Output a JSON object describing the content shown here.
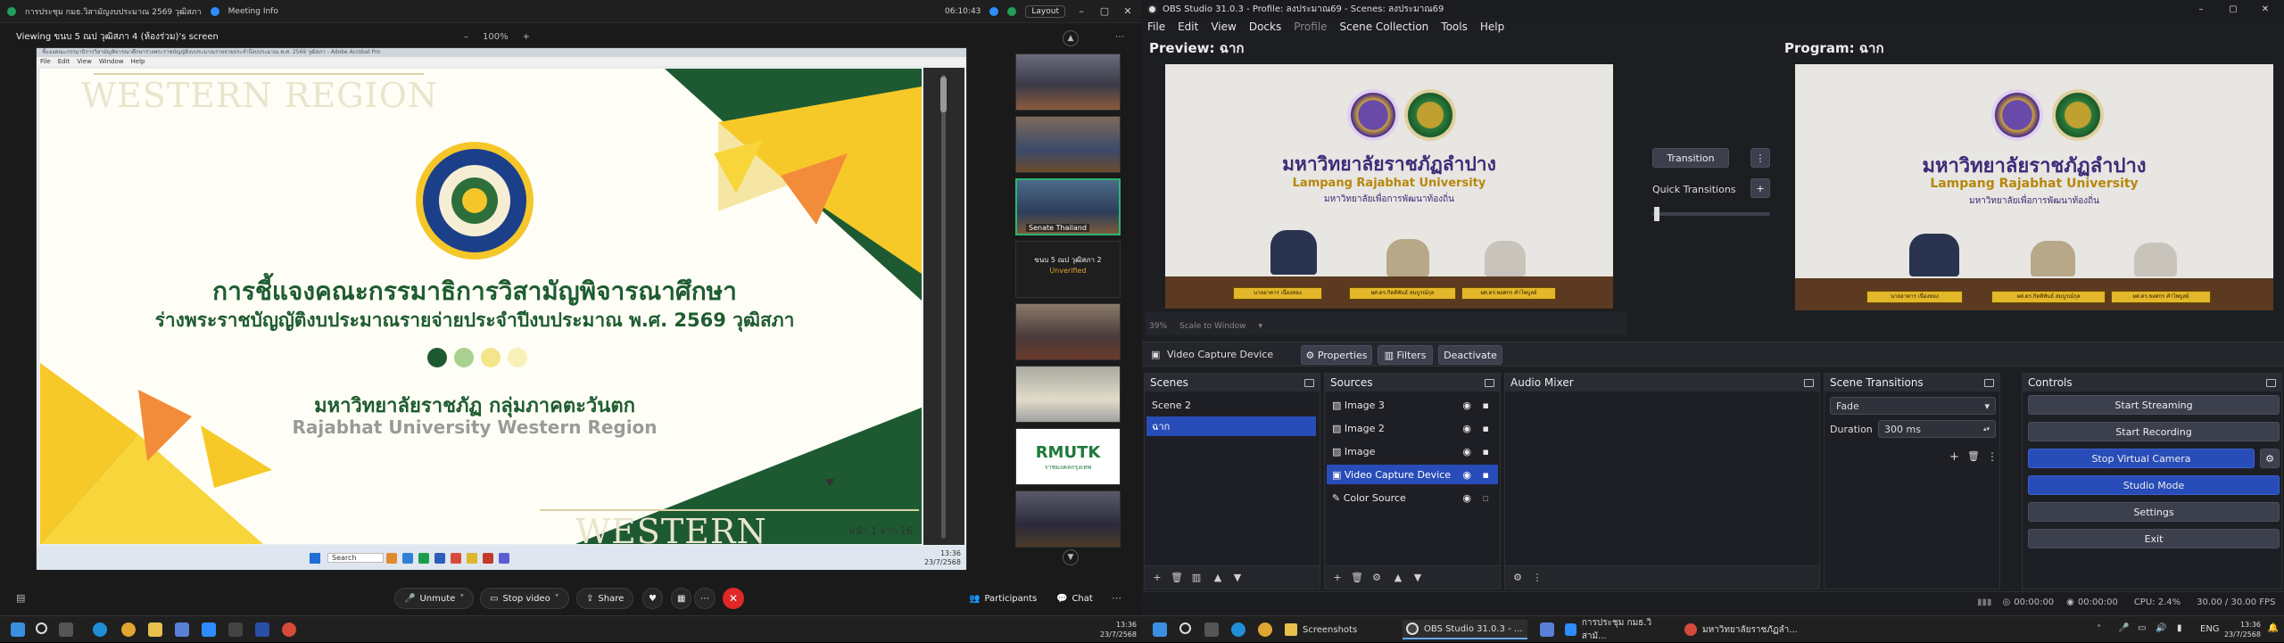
{
  "zoom": {
    "tab_title": "การประชุม กมธ.วิสามัญงบประมาณ 2569 วุฒิสภา",
    "meeting_info": "Meeting Info",
    "timer": "06:10:43",
    "layout_label": "Layout",
    "viewing_label": "Viewing ขนบ 5 ณป วุฒิสภา 4 (ห้องร่วม)'s screen",
    "zoom_pct": "100%",
    "ppt_title": "ชี้แจงคณะกรรมาธิการวิสามัญพิจารณาศึกษาร่างพระราชบัญญัติงบประมาณรายจ่ายประจำปีงบประมาณ พ.ศ. 2569 วุฒิสภา - Adobe Acrobat Pro",
    "ppt_menu": [
      "File",
      "Edit",
      "View",
      "Window",
      "Help"
    ],
    "slide": {
      "watermark_top": "WESTERN REGION",
      "watermark_bottom": "WESTERN REGION",
      "title_line1": "การชี้แจงคณะกรรมาธิการวิสามัญพิจารณาศึกษา",
      "title_line2": "ร่างพระราชบัญญัติงบประมาณรายจ่ายประจำปีงบประมาณ พ.ศ. 2569 วุฒิสภา",
      "org_th": "มหาวิทยาลัยราชภัฏ กลุ่มภาคตะวันตก",
      "org_en": "Rajabhat University Western Region",
      "page": "หน้า 1 จาก 16"
    },
    "mini_taskbar": {
      "search": "Search",
      "time": "13:36",
      "date": "23/7/2568"
    },
    "gallery": [
      {
        "name": ""
      },
      {
        "name": ""
      },
      {
        "name": "Senate Thailand"
      },
      {
        "name": "ขนบ 5 ณป วุฒิสภา 2",
        "note": "Unverified"
      },
      {
        "name": ""
      },
      {
        "name": ""
      },
      {
        "name": "RMUTK"
      },
      {
        "name": ""
      }
    ],
    "rmutk_sub": "ราชมงคลกรุงเทพ",
    "toolbar": {
      "unmute": "Unmute",
      "stop_video": "Stop video",
      "share": "Share",
      "participants": "Participants",
      "chat": "Chat"
    }
  },
  "obs": {
    "title": "OBS Studio 31.0.3 - Profile: ลงประมาณ69 - Scenes: ลงประมาณ69",
    "menu": [
      "File",
      "Edit",
      "View",
      "Docks",
      "Profile",
      "Scene Collection",
      "Tools",
      "Help"
    ],
    "preview_label": "Preview: ฉาก",
    "program_label": "Program: ฉาก",
    "uni_th": "มหาวิทยาลัยราชภัฏลำปาง",
    "uni_en": "Lampang Rajabhat University",
    "uni_sub": "มหาวิทยาลัยเพื่อการพัฒนาท้องถิ่น",
    "nameplates": [
      "นายอาคาร เนื่องทอง",
      "ผศ.ดร.กิตติพันธ์ สมบูรณ์กุล",
      "ผศ.ดร.พงศกร คำไพบูลย์"
    ],
    "scale_pct": "39%",
    "scale_mode": "Scale to Window",
    "transition_btn": "Transition",
    "quick_transitions": "Quick Transitions",
    "source_bar": {
      "source_name": "Video Capture Device",
      "properties": "Properties",
      "filters": "Filters",
      "deactivate": "Deactivate"
    },
    "docks": {
      "scenes": {
        "title": "Scenes",
        "items": [
          "Scene 2",
          "ฉาก"
        ],
        "selected": 1
      },
      "sources": {
        "title": "Sources",
        "items": [
          "Image 3",
          "Image 2",
          "Image",
          "Video Capture Device",
          "Color Source"
        ],
        "selected": 3
      },
      "mixer": {
        "title": "Audio Mixer"
      },
      "transitions": {
        "title": "Scene Transitions",
        "type": "Fade",
        "duration_label": "Duration",
        "duration": "300 ms"
      },
      "controls": {
        "title": "Controls",
        "buttons": [
          "Start Streaming",
          "Start Recording",
          "Stop Virtual Camera",
          "Studio Mode",
          "Settings",
          "Exit"
        ]
      }
    },
    "status": {
      "stream_time": "00:00:00",
      "rec_time": "00:00:00",
      "cpu": "CPU: 2.4%",
      "fps": "30.00 / 30.00 FPS"
    }
  },
  "taskbar_left": {
    "time": "13:36",
    "date": "23/7/2568"
  },
  "taskbar_right": {
    "apps": [
      "Screenshots",
      "OBS Studio 31.0.3 - ...",
      "การประชุม กมธ.วิสามั...",
      "มหาวิทยาลัยราชภัฏลำ..."
    ],
    "lang": "ENG",
    "time": "13:36",
    "date": "23/7/2568"
  },
  "colors": {
    "obs_accent": "#284cb8",
    "zoom_end": "#e02828",
    "slide_green": "#1e5c30",
    "slide_yellow": "#f7c928"
  }
}
